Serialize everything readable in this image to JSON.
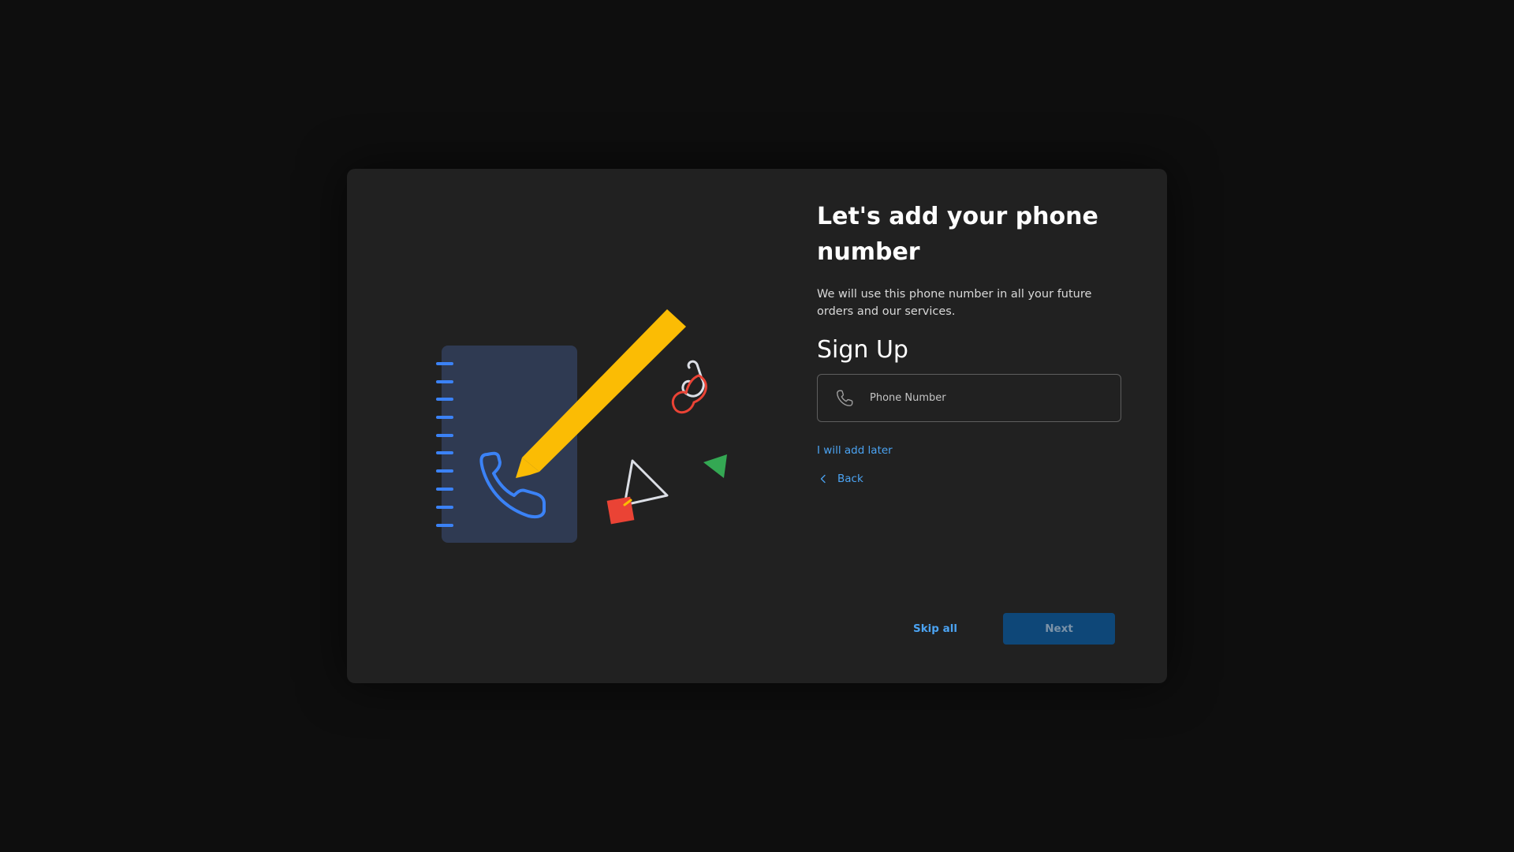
{
  "dialog": {
    "title": "Let's add your phone number",
    "description": "We will use this phone number in all your future orders and our services.",
    "section_heading": "Sign Up",
    "phone_field": {
      "placeholder": "Phone Number",
      "value": "",
      "icon": "phone-icon"
    },
    "add_later_label": "I will add later",
    "back_label": "Back",
    "skip_all_label": "Skip all",
    "next_label": "Next"
  },
  "colors": {
    "page_background": "#0e0e0e",
    "dialog_background": "#212121",
    "link": "#4ba3f2",
    "next_button_bg": "#0e4778",
    "next_button_text": "#7b92a7",
    "notebook": "#2f3a52",
    "notebook_spiral": "#3b82f6",
    "pencil": "#fbbc04",
    "red": "#ea4335",
    "green": "#34a853"
  },
  "illustration": {
    "icons": [
      "notebook-icon",
      "phone-icon",
      "pencil-icon",
      "paperclip-icon",
      "triangle-icon",
      "square-icon"
    ]
  }
}
